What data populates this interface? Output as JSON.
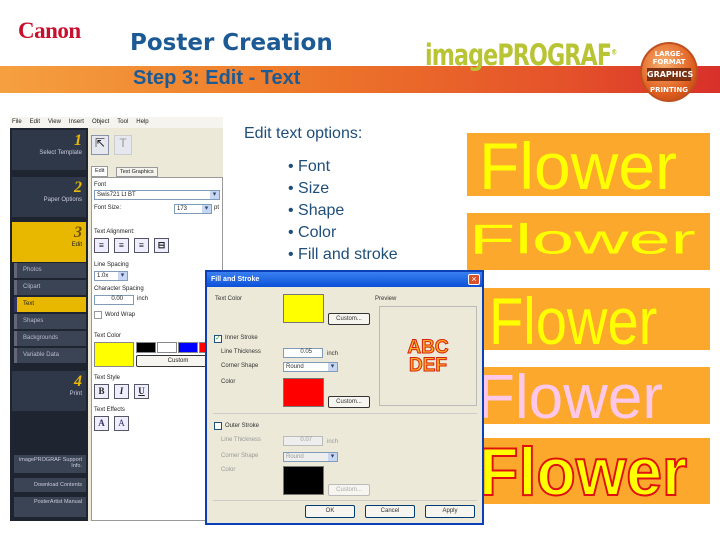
{
  "header": {
    "logo": "Canon",
    "title": "Poster Creation",
    "subtitle": "Step 3: Edit - Text",
    "brand": "imagePROGRAF",
    "brand_mark": "®",
    "badge": {
      "top": "LARGE-FORMAT",
      "middle": "GRAPHICS",
      "bottom": "PRINTING"
    }
  },
  "app": {
    "menu": [
      "File",
      "Edit",
      "View",
      "Insert",
      "Object",
      "Tool",
      "Help"
    ],
    "steps": [
      {
        "num": "1",
        "label": "Select Template"
      },
      {
        "num": "2",
        "label": "Paper Options"
      },
      {
        "num": "3",
        "label": "Edit"
      },
      {
        "num": "4",
        "label": "Print"
      }
    ],
    "edit_items": [
      "Photos",
      "Clipart",
      "Text",
      "Shapes",
      "Backgrounds",
      "Variable Data"
    ],
    "active_item": "Text",
    "bottom_buttons": [
      "imagePROGRAF Support Info.",
      "Download Contents",
      "PosterArtist Manual"
    ],
    "tabs": [
      "Edit",
      "Text Graphics"
    ],
    "font_label": "Font",
    "font_value": "Swis721 Lt BT",
    "size_label": "Font Size:",
    "size_value": "173",
    "size_unit": "pt",
    "alignment_label": "Text Alignment:",
    "line_spacing_label": "Line Spacing",
    "line_spacing_value": "1.0x",
    "char_spacing_label": "Character Spacing",
    "char_spacing_value": "0.00",
    "char_spacing_unit": "inch",
    "word_wrap_label": "Word Wrap",
    "text_color_label": "Text Color",
    "custom_label": "Custom",
    "text_style_label": "Text Style",
    "style_buttons": [
      "B",
      "I",
      "U"
    ],
    "text_effects_label": "Text Effects",
    "effect_buttons": [
      "A",
      "A"
    ],
    "colors": {
      "selected": "#ffff00",
      "swatches": [
        "#000000",
        "#ffffff",
        "#0000ff",
        "#ff0000"
      ]
    }
  },
  "options": {
    "title": "Edit text options:",
    "items": [
      "Font",
      "Size",
      "Shape",
      "Color",
      "Fill and stroke"
    ]
  },
  "dialog": {
    "title": "Fill and Stroke",
    "close": "×",
    "text_color_label": "Text Color",
    "text_color": "#ffff00",
    "custom": "Custom...",
    "preview_label": "Preview",
    "preview_lines": [
      "ABC",
      "DEF"
    ],
    "inner": {
      "label": "Inner Stroke",
      "checked": true,
      "thickness_label": "Line Thickness",
      "thickness": "0.05",
      "unit": "inch",
      "corner_label": "Corner Shape",
      "corner": "Round",
      "color_label": "Color",
      "color": "#ff0000",
      "custom": "Custom..."
    },
    "outer": {
      "label": "Outer Stroke",
      "checked": false,
      "thickness_label": "Line Thickness",
      "thickness": "0.07",
      "unit": "inch",
      "corner_label": "Corner Shape",
      "corner": "Round",
      "color_label": "Color",
      "color": "#000000",
      "custom": "Custom..."
    },
    "buttons": [
      "OK",
      "Cancel",
      "Apply"
    ]
  },
  "samples": {
    "word": "Flower",
    "background": "#fba82c",
    "colors": [
      "#ffff00",
      "#ffff00",
      "#ffff00",
      "#ffc8e8",
      "#ffff00"
    ],
    "stroke": "#e01010"
  }
}
